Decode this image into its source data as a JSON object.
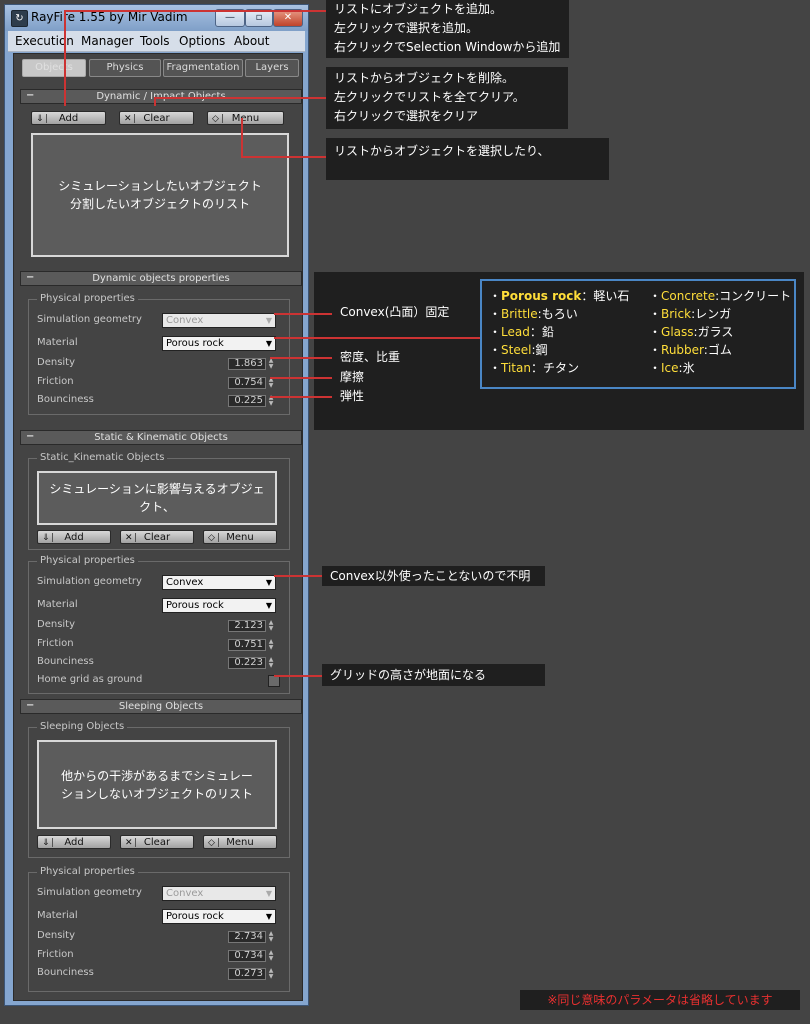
{
  "window": {
    "title": "RayFire 1.55    by Mir Vadim",
    "icon_name": "rayfire-app-icon",
    "minimize_label": "—",
    "maximize_label": "▫",
    "close_label": "✕"
  },
  "menu": [
    "Execution",
    "Manager",
    "Tools",
    "Options",
    "About"
  ],
  "tabs": [
    "Objects",
    "Physics",
    "Fragmentation",
    "Layers"
  ],
  "buttons": {
    "add": "Add",
    "clear": "Clear",
    "menu": "Menu"
  },
  "labels": {
    "physical_properties": "Physical properties",
    "simulation_geometry": "Simulation geometry",
    "material": "Material",
    "density": "Density",
    "friction": "Friction",
    "bounciness": "Bounciness",
    "home_grid": "Home grid as ground"
  },
  "dynamic": {
    "rollout_title": "Dynamic / Impact Objects",
    "list_text": "シミュレーションしたいオブジェクト\n分割したいオブジェクトのリスト",
    "props_rollout_title": "Dynamic objects properties",
    "sim_geometry": "Convex",
    "material": "Porous rock",
    "density": "1.863",
    "friction": "0.754",
    "bounciness": "0.225"
  },
  "static": {
    "rollout_title": "Static & Kinematic Objects",
    "group_title": "Static_Kinematic Objects",
    "list_text": "シミュレーションに影響与えるオブジェ\nクト、",
    "sim_geometry": "Convex",
    "material": "Porous rock",
    "density": "2.123",
    "friction": "0.751",
    "bounciness": "0.223"
  },
  "sleeping": {
    "rollout_title": "Sleeping Objects",
    "group_title": "Sleeping Objects",
    "list_text": "他からの干渉があるまでシミュレー\nションしないオブジェクトのリスト",
    "sim_geometry": "Convex",
    "material": "Porous rock",
    "density": "2.734",
    "friction": "0.734",
    "bounciness": "0.273"
  },
  "annotations": {
    "add_note": "リストにオブジェクトを追加。\n左クリックで選択を追加。\n右クリックでSelection Windowから追加",
    "clear_note": "リストからオブジェクトを削除。\n左クリックでリストを全てクリア。\n右クリックで選択をクリア",
    "menu_note": "リストからオブジェクトを選択したり、",
    "convex_note": "Convex(凸面）固定",
    "density_note": "密度、比重",
    "friction_note": "摩擦",
    "bounciness_note": "弾性",
    "convex_only_note": "Convex以外使ったことないので不明",
    "grid_note": "グリッドの高さが地面になる",
    "warning": "※同じ意味のパラメータは省略しています"
  },
  "materials_legend": [
    {
      "name": "Porous rock",
      "jp": "軽い石"
    },
    {
      "name": "Brittle",
      "jp": "もろい"
    },
    {
      "name": "Lead",
      "jp": "鉛"
    },
    {
      "name": "Steel",
      "jp": "鋼"
    },
    {
      "name": "Titan",
      "jp": "チタン"
    },
    {
      "name": "Concrete",
      "jp": "コンクリート"
    },
    {
      "name": "Brick",
      "jp": "レンガ"
    },
    {
      "name": "Glass",
      "jp": "ガラス"
    },
    {
      "name": "Rubber",
      "jp": "ゴム"
    },
    {
      "name": "Ice",
      "jp": "氷"
    }
  ],
  "colors": {
    "annotation_line": "#cc3333",
    "legend_border": "#4a86c5",
    "legend_key": "#ffde3a",
    "warning_text": "#e83030"
  }
}
